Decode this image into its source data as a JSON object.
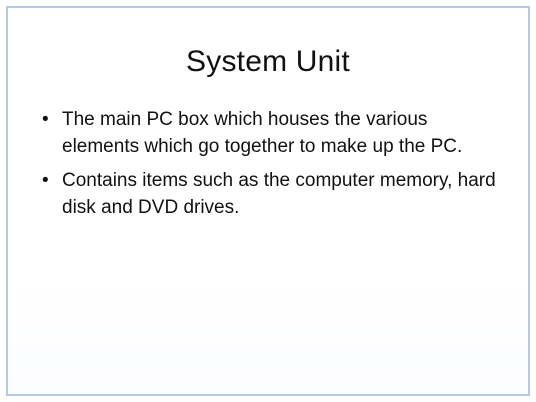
{
  "slide": {
    "title": "System Unit",
    "bullets": [
      {
        "marker": "•",
        "text": "The main PC box which houses the various elements which go together to make up the PC."
      },
      {
        "marker": "•",
        "text": "Contains items such as the computer memory, hard disk and DVD drives."
      }
    ]
  }
}
